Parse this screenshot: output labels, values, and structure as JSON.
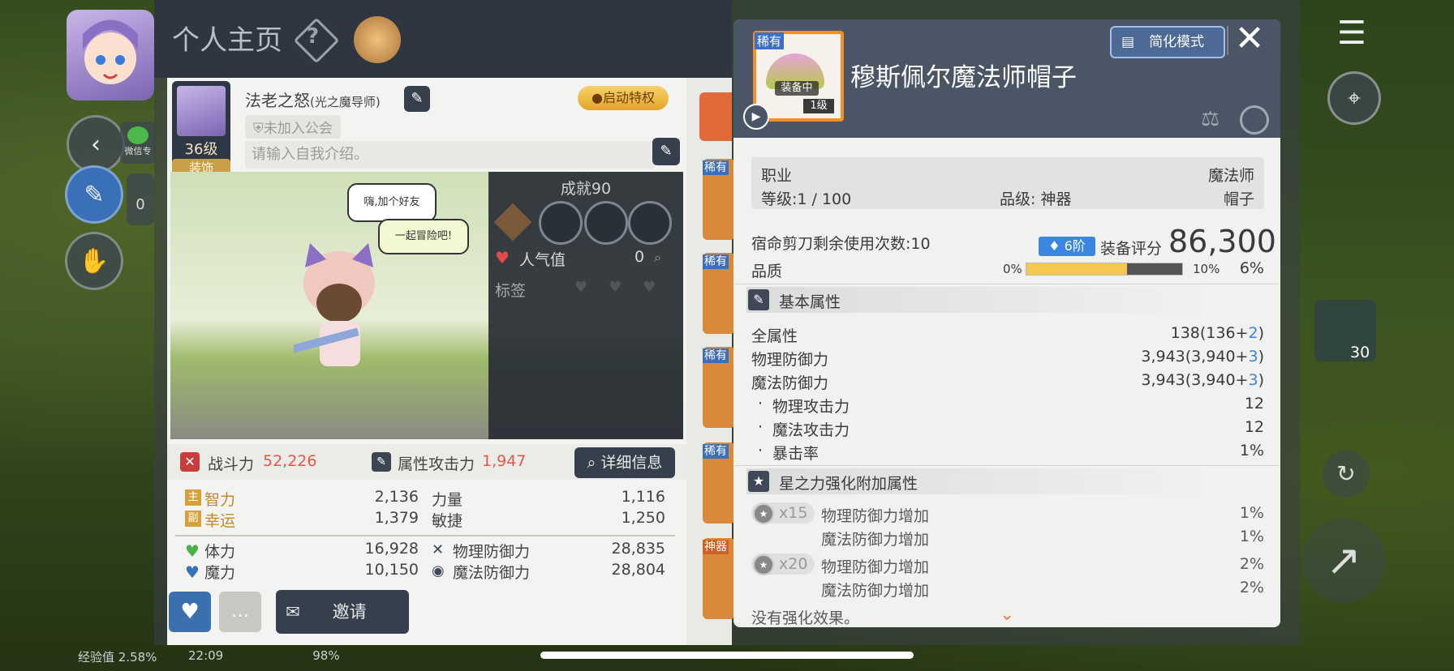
{
  "profile": {
    "title": "个人主页",
    "char_name_main": "法老之怒",
    "char_name_sub": "(光之魔导师)",
    "guild": "未加入公会",
    "privilege_btn": "启动特权",
    "level": "36级",
    "deco_label": "装饰",
    "intro_placeholder": "请输入自我介绍。",
    "bubble1": "嗨,加个好友",
    "bubble2": "一起冒险吧!",
    "achievement": "成就90",
    "popularity_label": "人气值",
    "popularity_value": "0",
    "tag_label": "标签",
    "combat_label": "战斗力",
    "combat_value": "52,226",
    "attr_attack_label": "属性攻击力",
    "attr_attack_value": "1,947",
    "detail_btn": "详细信息",
    "stats": [
      {
        "badge": "主",
        "label": "智力",
        "value": "2,136",
        "label2": "力量",
        "value2": "1,116"
      },
      {
        "badge": "副",
        "label": "幸运",
        "value": "1,379",
        "label2": "敏捷",
        "value2": "1,250"
      }
    ],
    "stats2": [
      {
        "label": "体力",
        "value": "16,928",
        "label2": "物理防御力",
        "value2": "28,835"
      },
      {
        "label": "魔力",
        "value": "10,150",
        "label2": "魔法防御力",
        "value2": "28,804"
      }
    ],
    "invite_btn": "邀请",
    "side_label_wechat": "微信专",
    "side_count": "0"
  },
  "status_bar": {
    "exp": "经验值 2.58%",
    "time": "22:09",
    "battery": "98%",
    "potion_count": "30"
  },
  "equip_list": {
    "rare_labels": [
      "稀有",
      "稀有",
      "稀有",
      "稀有"
    ],
    "artifact_label": "神器"
  },
  "item": {
    "rarity": "稀有",
    "equipped": "装备中",
    "level_tag": "1级",
    "name": "穆斯佩尔魔法师帽子",
    "simplify_btn": "简化模式",
    "job_label": "职业",
    "job_value": "魔法师",
    "level_line": "等级:1 / 100",
    "grade_line": "品级: 神器",
    "slot_value": "帽子",
    "scissors": "宿命剪刀剩余使用次数:10",
    "tier": "6阶",
    "score_label": "装备评分",
    "score_value": "86,300",
    "quality_label": "品质",
    "quality_min": "0%",
    "quality_max": "10%",
    "quality_value": "6%",
    "quality_fill": 0.64,
    "basic_title": "基本属性",
    "basic": [
      {
        "label": "全属性",
        "base": "138(136+",
        "bonus": "2",
        "close": ")"
      },
      {
        "label": "物理防御力",
        "base": "3,943(3,940+",
        "bonus": "3",
        "close": ")"
      },
      {
        "label": "魔法防御力",
        "base": "3,943(3,940+",
        "bonus": "3",
        "close": ")"
      }
    ],
    "basic_sub": [
      {
        "label": "物理攻击力",
        "value": "12"
      },
      {
        "label": "魔法攻击力",
        "value": "12"
      },
      {
        "label": "暴击率",
        "value": "1%"
      }
    ],
    "star_title": "星之力强化附加属性",
    "star_groups": [
      {
        "count": "x15",
        "rows": [
          {
            "label": "物理防御力增加",
            "value": "1%"
          },
          {
            "label": "魔法防御力增加",
            "value": "1%"
          }
        ]
      },
      {
        "count": "x20",
        "rows": [
          {
            "label": "物理防御力增加",
            "value": "2%"
          },
          {
            "label": "魔法防御力增加",
            "value": "2%"
          }
        ]
      }
    ],
    "no_enhance": "没有强化效果。"
  },
  "colors": {
    "accent_orange": "#f0902a",
    "rare_blue": "#3d70c4",
    "bonus_blue": "#3a86e0",
    "combat_red": "#e05a4a"
  },
  "icons": [
    "question-icon",
    "edit-icon",
    "back-icon",
    "close-icon",
    "doc-icon",
    "play-icon",
    "compare-icon",
    "lock-icon",
    "star-icon",
    "heart-icon",
    "chat-icon",
    "mail-icon",
    "search-icon",
    "menu-icon",
    "location-icon",
    "chevron-down-icon"
  ]
}
